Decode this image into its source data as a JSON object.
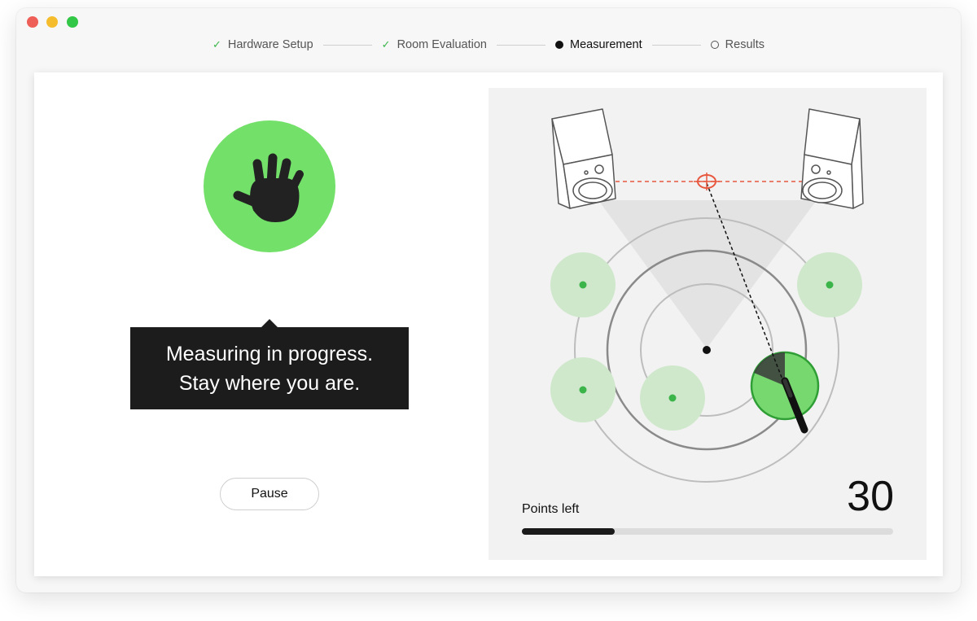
{
  "stepper": {
    "steps": [
      {
        "label": "Hardware Setup",
        "state": "done"
      },
      {
        "label": "Room Evaluation",
        "state": "done"
      },
      {
        "label": "Measurement",
        "state": "active"
      },
      {
        "label": "Results",
        "state": "pending"
      }
    ]
  },
  "measurement": {
    "status_line1": "Measuring in progress.",
    "status_line2": "Stay where you are.",
    "pause_label": "Pause",
    "hand_icon": "hand-stop-icon",
    "accent_color": "#73e069"
  },
  "points": {
    "label": "Points left",
    "count": "30",
    "progress_fraction": 0.25
  },
  "colors": {
    "check": "#3bb54a",
    "target": "#e8583f",
    "measure_point": "#3bb54a"
  }
}
